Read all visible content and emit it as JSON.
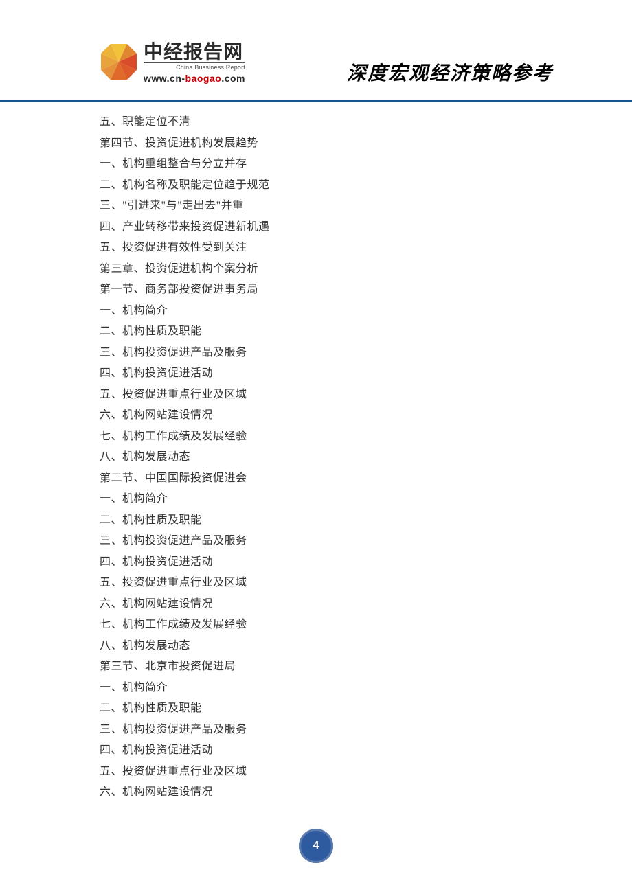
{
  "logo": {
    "cn": "中经报告网",
    "en": "China Bussiness Report",
    "url_plain": "www.cn-",
    "url_accent": "baogao",
    "url_suffix": ".com"
  },
  "header_tagline": "深度宏观经济策略参考",
  "lines": [
    "五、职能定位不清",
    "第四节、投资促进机构发展趋势",
    "一、机构重组整合与分立并存",
    "二、机构名称及职能定位趋于规范",
    "三、\"引进来\"与\"走出去\"并重",
    "四、产业转移带来投资促进新机遇",
    "五、投资促进有效性受到关注",
    "第三章、投资促进机构个案分析",
    "第一节、商务部投资促进事务局",
    "一、机构简介",
    "二、机构性质及职能",
    "三、机构投资促进产品及服务",
    "四、机构投资促进活动",
    "五、投资促进重点行业及区域",
    "六、机构网站建设情况",
    "七、机构工作成绩及发展经验",
    "八、机构发展动态",
    "第二节、中国国际投资促进会",
    "一、机构简介",
    "二、机构性质及职能",
    "三、机构投资促进产品及服务",
    "四、机构投资促进活动",
    "五、投资促进重点行业及区域",
    "六、机构网站建设情况",
    "七、机构工作成绩及发展经验",
    "八、机构发展动态",
    "第三节、北京市投资促进局",
    "一、机构简介",
    "二、机构性质及职能",
    "三、机构投资促进产品及服务",
    "四、机构投资促进活动",
    "五、投资促进重点行业及区域",
    "六、机构网站建设情况"
  ],
  "page_number": "4"
}
